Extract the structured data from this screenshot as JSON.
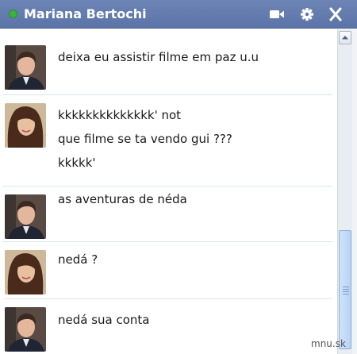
{
  "chat": {
    "contact_name": "Mariana Bertochi",
    "status": "online"
  },
  "header_icons": [
    "video-camera-icon",
    "gear-icon",
    "close-icon"
  ],
  "messages": [
    {
      "sender": "boy",
      "lines": [
        "deixa eu assistir filme em paz u.u"
      ]
    },
    {
      "sender": "girl",
      "lines": [
        "kkkkkkkkkkkkkk' not",
        "que filme se ta vendo gui ???",
        "kkkkk'"
      ]
    },
    {
      "sender": "boy",
      "lines": [
        "as aventuras de néda"
      ]
    },
    {
      "sender": "girl",
      "lines": [
        "nedá ?"
      ]
    },
    {
      "sender": "boy",
      "lines": [
        "nedá sua conta"
      ]
    }
  ],
  "watermark": "mnu.sk",
  "colors": {
    "header": "#6d84b4",
    "status_online": "#3cb23c",
    "scroll_thumb": "#b8d3f5"
  }
}
